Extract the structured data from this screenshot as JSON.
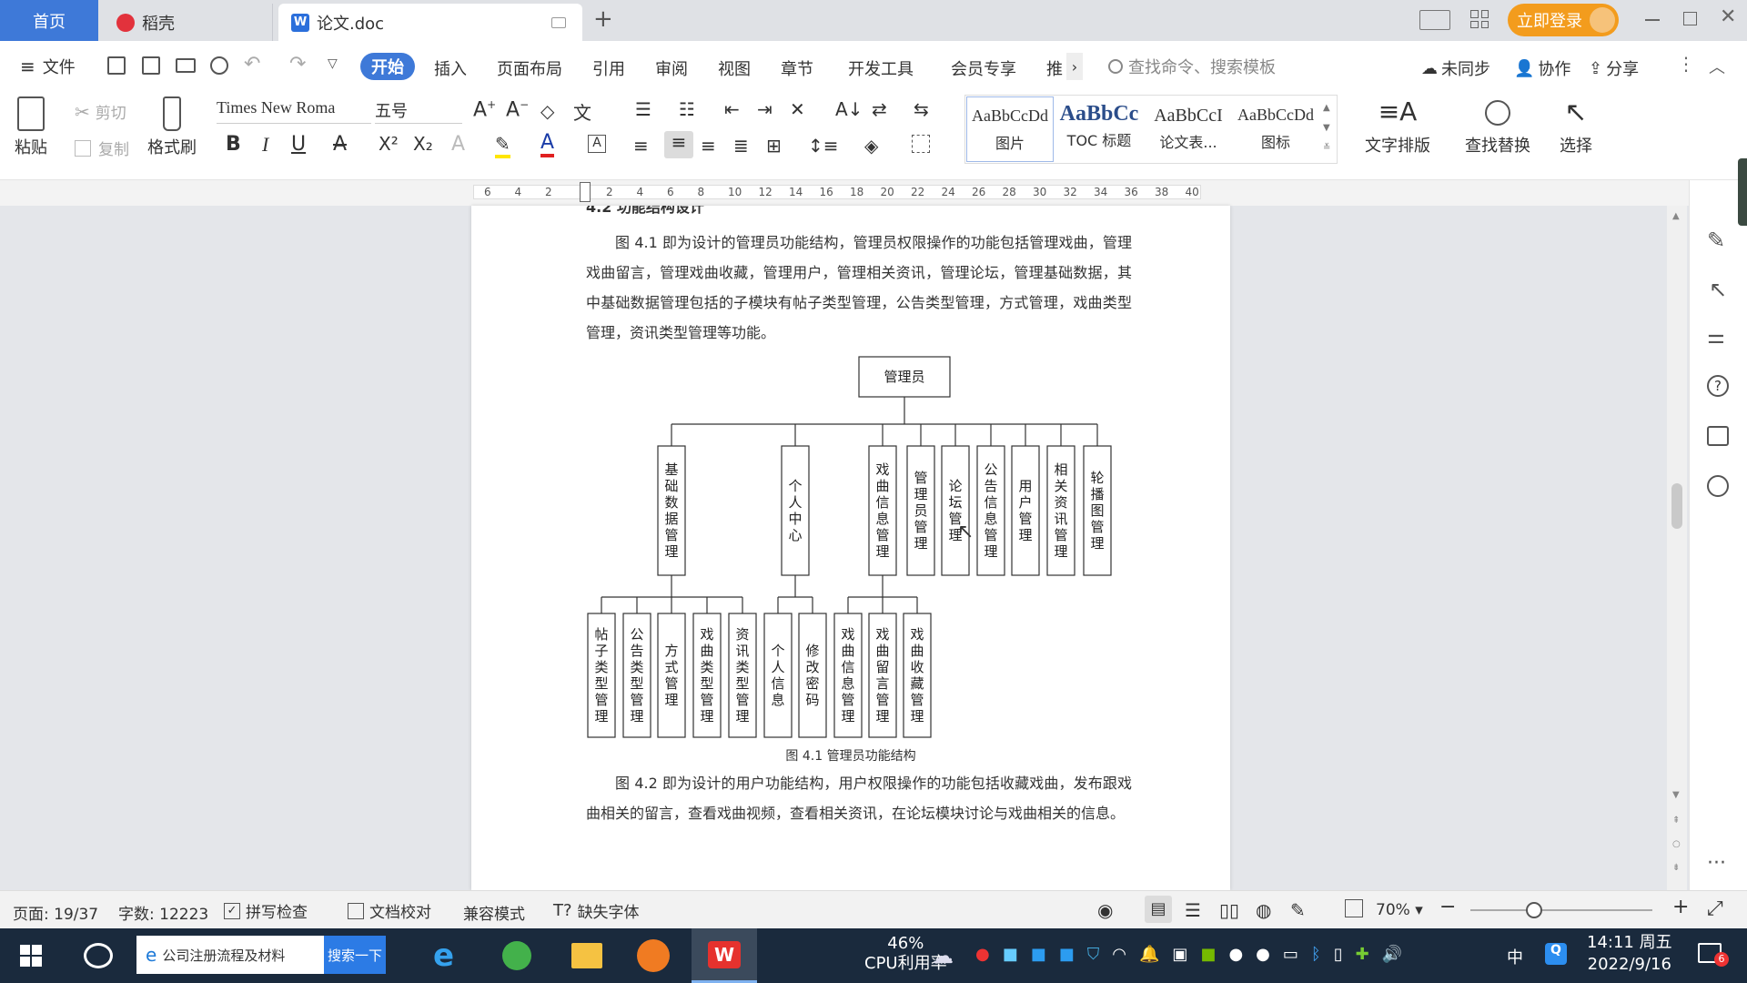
{
  "tabs": {
    "home": "首页",
    "daoke": "稻壳",
    "doc": "论文.doc"
  },
  "titlebar": {
    "login": "立即登录"
  },
  "menu": {
    "file": "文件",
    "items": [
      "开始",
      "插入",
      "页面布局",
      "引用",
      "审阅",
      "视图",
      "章节",
      "开发工具",
      "会员专享",
      "推"
    ],
    "more": "›",
    "search_placeholder": "查找命令、搜索模板",
    "unsync": "未同步",
    "collab": "协作",
    "share": "分享"
  },
  "ribbon": {
    "paste": "粘贴",
    "cut": "剪切",
    "copy": "复制",
    "format_painter": "格式刷",
    "font_name": "Times New Roma",
    "font_size": "五号",
    "bold": "B",
    "italic": "I",
    "underline": "U",
    "styles": [
      {
        "sample": "AaBbCcDd",
        "name": "图片"
      },
      {
        "sample": "AaBbCc",
        "name": "TOC 标题"
      },
      {
        "sample": "AaBbCcI",
        "name": "论文表..."
      },
      {
        "sample": "AaBbCcDd",
        "name": "图标"
      }
    ],
    "text_layout": "文字排版",
    "find_replace": "查找替换",
    "select": "选择"
  },
  "ruler": {
    "ticks": [
      "6",
      "4",
      "2",
      "",
      "2",
      "4",
      "6",
      "8",
      "10",
      "12",
      "14",
      "16",
      "18",
      "20",
      "22",
      "24",
      "26",
      "28",
      "30",
      "32",
      "34",
      "36",
      "38",
      "40"
    ]
  },
  "doc": {
    "heading_partial": "4.2  功能结构设计",
    "para1": "图 4.1 即为设计的管理员功能结构，管理员权限操作的功能包括管理戏曲，管理戏曲留言，管理戏曲收藏，管理用户，管理相关资讯，管理论坛，管理基础数据，其中基础数据管理包括的子模块有帖子类型管理，公告类型管理，方式管理，戏曲类型管理，资讯类型管理等功能。",
    "caption": "图 4.1  管理员功能结构",
    "para2": "图 4.2 即为设计的用户功能结构，用户权限操作的功能包括收藏戏曲，发布跟戏曲相关的留言，查看戏曲视频，查看相关资讯，在论坛模块讨论与戏曲相关的信息。"
  },
  "diagram": {
    "root": "管理员",
    "level1": [
      "基础数据管理",
      "个人中心",
      "戏曲信息管理",
      "管理员管理",
      "论坛管理",
      "公告信息管理",
      "用户管理",
      "相关资讯管理",
      "轮播图管理"
    ],
    "level2": [
      "帖子类型管理",
      "公告类型管理",
      "方式管理",
      "戏曲类型管理",
      "资讯类型管理",
      "个人信息",
      "修改密码",
      "戏曲信息管理",
      "戏曲留言管理",
      "戏曲收藏管理"
    ]
  },
  "status": {
    "page": "页面: 19/37",
    "words": "字数: 12223",
    "spell": "拼写检查",
    "proof": "文档校对",
    "compat": "兼容模式",
    "missing_font": "缺失字体",
    "zoom": "70%",
    "zoom_value": 0.35
  },
  "taskbar": {
    "search_text": "公司注册流程及材料",
    "search_btn": "搜索一下",
    "cpu": "46%",
    "cpu_label": "CPU利用率",
    "ime": "中",
    "time": "14:11 周五",
    "date": "2022/9/16",
    "badge": "6"
  }
}
